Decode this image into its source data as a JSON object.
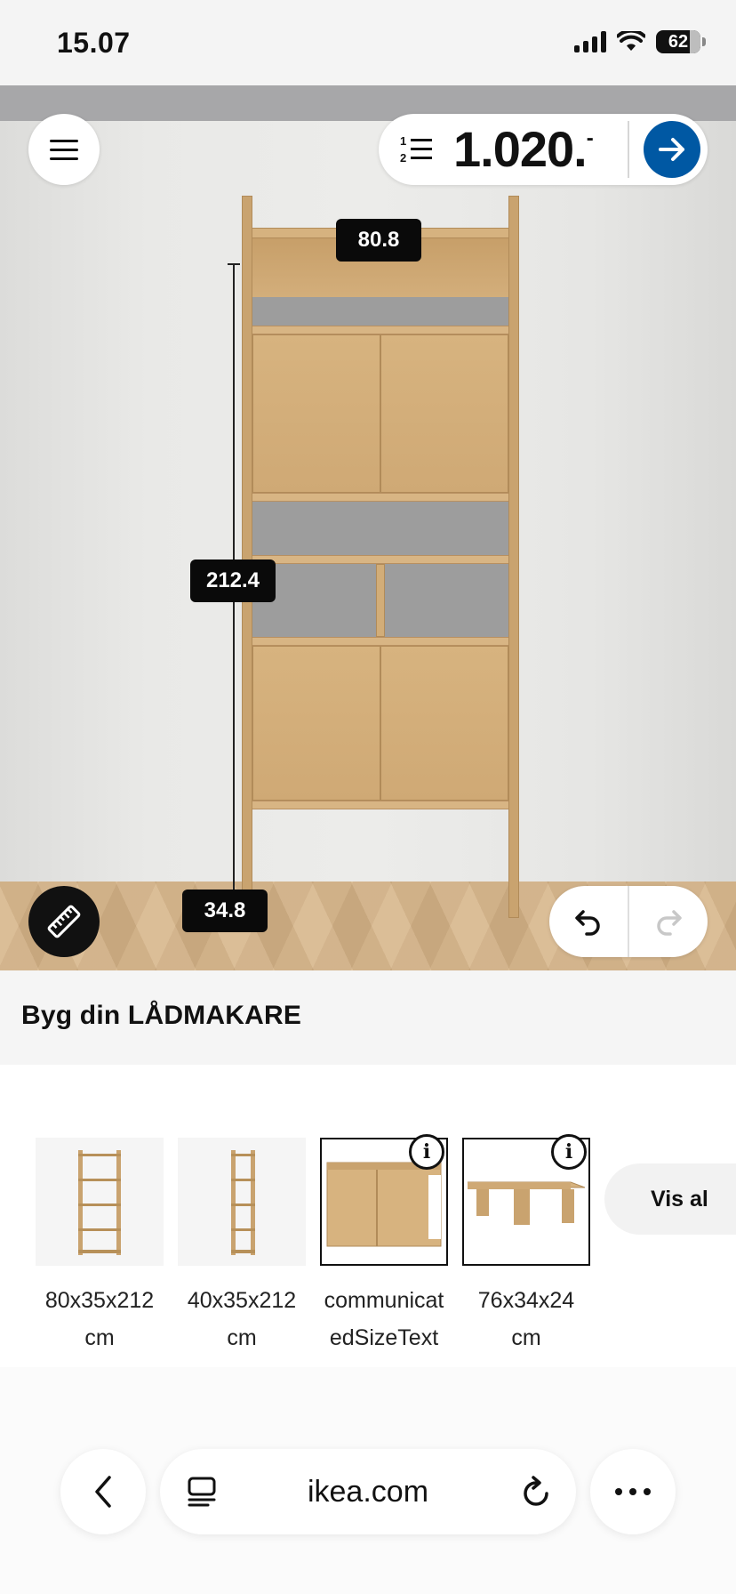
{
  "status_bar": {
    "time": "15.07",
    "battery": "62"
  },
  "scene": {
    "price": "1.020.",
    "price_suffix": "-",
    "dimensions": {
      "width": "80.8",
      "height": "212.4",
      "depth": "34.8"
    }
  },
  "title": "Byg din LÅDMAKARE",
  "products": [
    {
      "label": "80x35x212 cm",
      "selected": false,
      "icon": "shelf-tall-image"
    },
    {
      "label": "40x35x212 cm",
      "selected": false,
      "icon": "shelf-narrow-image"
    },
    {
      "label": "communicatedSizeText",
      "selected": true,
      "icon": "cabinet-sliding-doors-image"
    },
    {
      "label": "76x34x24 cm",
      "selected": true,
      "icon": "low-bench-image"
    }
  ],
  "vis_all_label": "Vis al",
  "browser": {
    "url": "ikea.com"
  },
  "colors": {
    "ikea_blue": "#0058a3",
    "wood": "#d2ad78",
    "label_bg": "#0a0a0a"
  }
}
